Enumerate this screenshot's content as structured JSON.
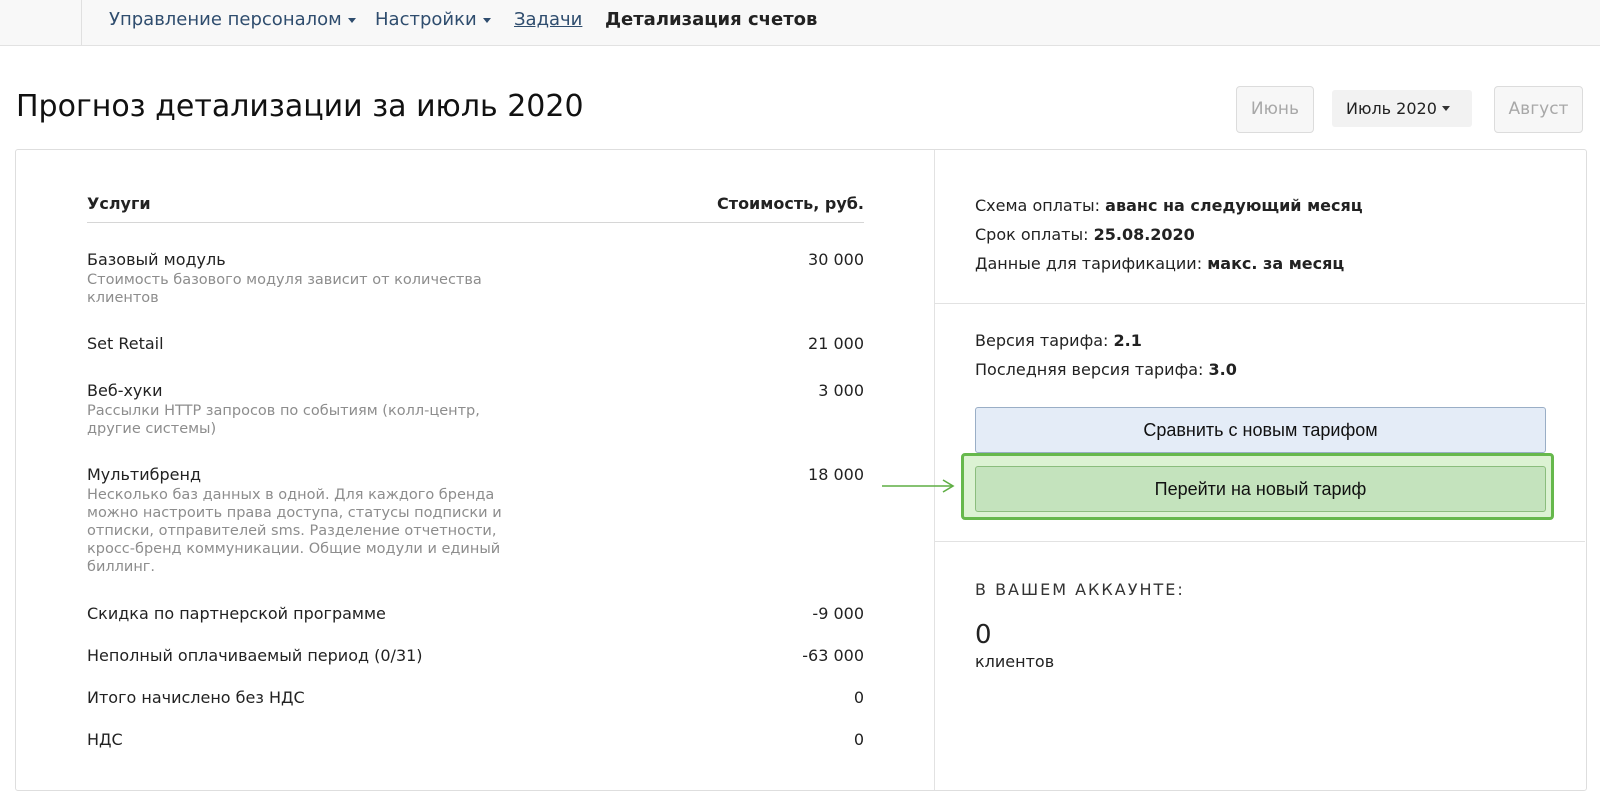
{
  "nav": {
    "items": [
      {
        "label": "Управление персоналом",
        "has_caret": true
      },
      {
        "label": "Настройки",
        "has_caret": true
      },
      {
        "label": "Задачи",
        "link": true
      },
      {
        "label": "Детализация счетов",
        "active": true
      }
    ]
  },
  "header": {
    "title": "Прогноз детализации за июль 2020",
    "prev_month": "Июнь",
    "selected_month": "Июль 2020",
    "next_month": "Август"
  },
  "services": {
    "col_service": "Услуги",
    "col_cost": "Стоимость, руб.",
    "rows": [
      {
        "name": "Базовый модуль",
        "desc": "Стоимость базового модуля зависит от количества клиентов",
        "value": "30 000"
      },
      {
        "name": "Set Retail",
        "desc": "",
        "value": "21 000"
      },
      {
        "name": "Веб-хуки",
        "desc": "Рассылки HTTP запросов по событиям (колл-центр, другие системы)",
        "value": "3 000"
      },
      {
        "name": "Мультибренд",
        "desc": "Несколько баз данных в одной. Для каждого бренда можно настроить права доступа, статусы подписки и отписки, отправителей sms. Разделение отчетности, кросс-бренд коммуникации. Общие модули и единый биллинг.",
        "value": "18 000"
      },
      {
        "name": "Скидка по партнерской программе",
        "desc": "",
        "value": "-9 000"
      },
      {
        "name": "Неполный оплачиваемый период (0/31)",
        "desc": "",
        "value": "-63 000"
      },
      {
        "name": "Итого начислено без НДС",
        "desc": "",
        "value": "0"
      },
      {
        "name": "НДС",
        "desc": "",
        "value": "0"
      }
    ]
  },
  "payment": {
    "scheme_label": "Схема оплаты:",
    "scheme_value": "аванс на следующий месяц",
    "due_label": "Срок оплаты:",
    "due_value": "25.08.2020",
    "tariff_data_label": "Данные для тарификации:",
    "tariff_data_value": "макс. за месяц"
  },
  "tariff": {
    "version_label": "Версия тарифа:",
    "version_value": "2.1",
    "latest_label": "Последняя версия тарифа:",
    "latest_value": "3.0",
    "compare_button": "Сравнить с новым тарифом",
    "switch_button": "Перейти на новый тариф"
  },
  "account": {
    "heading": "В ВАШЕМ АККАУНТЕ:",
    "clients_count": "0",
    "clients_label": "клиентов"
  },
  "colors": {
    "nav_link": "#2f4d6e",
    "highlight_border": "#66b84c",
    "compare_button_bg": "#e4ecf7",
    "switch_button_bg": "#c4e3bd"
  }
}
